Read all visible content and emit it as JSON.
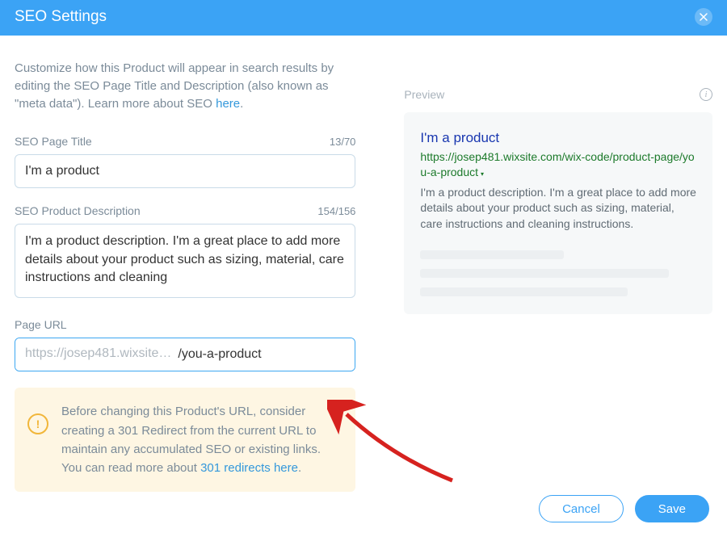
{
  "header": {
    "title": "SEO Settings"
  },
  "intro": {
    "text_before": "Customize how this Product will appear in search results by editing the SEO Page Title and Description (also known as \"meta data\"). Learn more about SEO ",
    "link_text": "here",
    "text_after": "."
  },
  "fields": {
    "title": {
      "label": "SEO Page Title",
      "counter": "13/70",
      "value": "I'm a product"
    },
    "description": {
      "label": "SEO Product Description",
      "counter": "154/156",
      "value": "I'm a product description. I'm a great place to add more details about your product such as sizing, material, care instructions and cleaning"
    },
    "url": {
      "label": "Page URL",
      "prefix": "https://josep481.wixsite…",
      "value": "/you-a-product"
    }
  },
  "warning": {
    "text_before": "Before changing this Product's URL, consider creating a 301 Redirect from the current URL to maintain any accumulated SEO or existing links. You can read more about ",
    "link_text": "301 redirects here",
    "text_after": "."
  },
  "preview": {
    "label": "Preview",
    "title": "I'm a product",
    "url": "https://josep481.wixsite.com/wix-code/product-page/you-a-product",
    "description": "I'm a product description. I'm a great place to add more details about your product such as sizing, material, care instructions and cleaning instructions."
  },
  "footer": {
    "cancel": "Cancel",
    "save": "Save"
  }
}
